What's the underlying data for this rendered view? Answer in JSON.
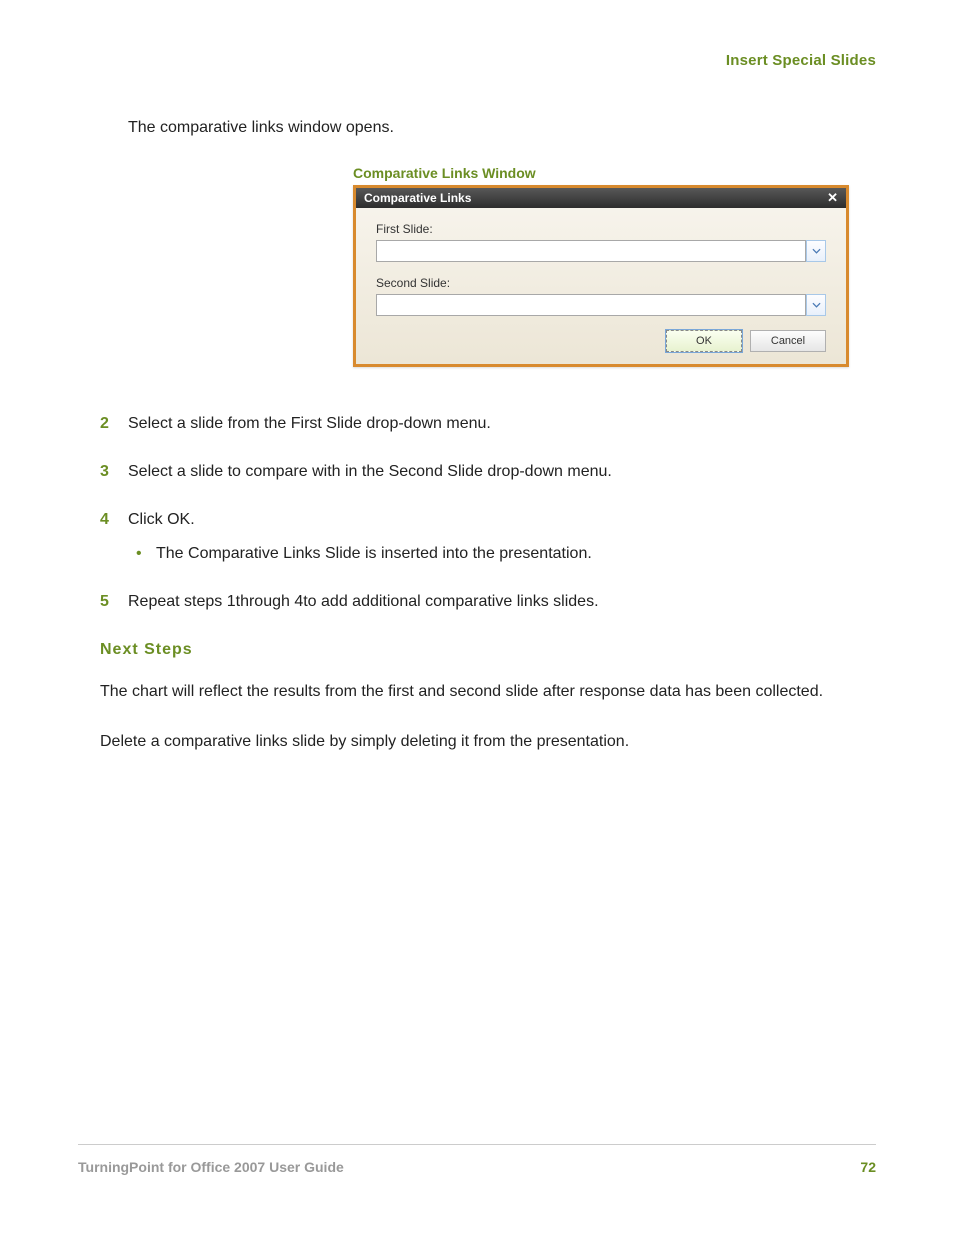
{
  "header": {
    "section": "Insert Special Slides"
  },
  "intro": "The comparative links window opens.",
  "figure": {
    "caption": "Comparative Links Window",
    "dialog": {
      "title": "Comparative Links",
      "field1_label": "First Slide:",
      "field2_label": "Second Slide:",
      "ok": "OK",
      "cancel": "Cancel"
    }
  },
  "steps": [
    {
      "num": "2",
      "text": "Select a slide from the First Slide drop-down menu."
    },
    {
      "num": "3",
      "text": "Select a slide to compare with in the Second Slide drop-down menu."
    },
    {
      "num": "4",
      "text": "Click OK."
    },
    {
      "num": "5",
      "text": "Repeat steps 1through 4to add additional comparative links slides."
    }
  ],
  "bullet_after_step4": "The Comparative Links Slide is inserted into the presentation.",
  "next_steps_heading": "Next Steps",
  "paragraphs": [
    "The chart will reflect the results from the first and second slide after response data has been collected.",
    "Delete a comparative links slide by simply deleting it from the presentation."
  ],
  "footer": {
    "left": "TurningPoint for Office 2007 User Guide",
    "right": "72"
  }
}
